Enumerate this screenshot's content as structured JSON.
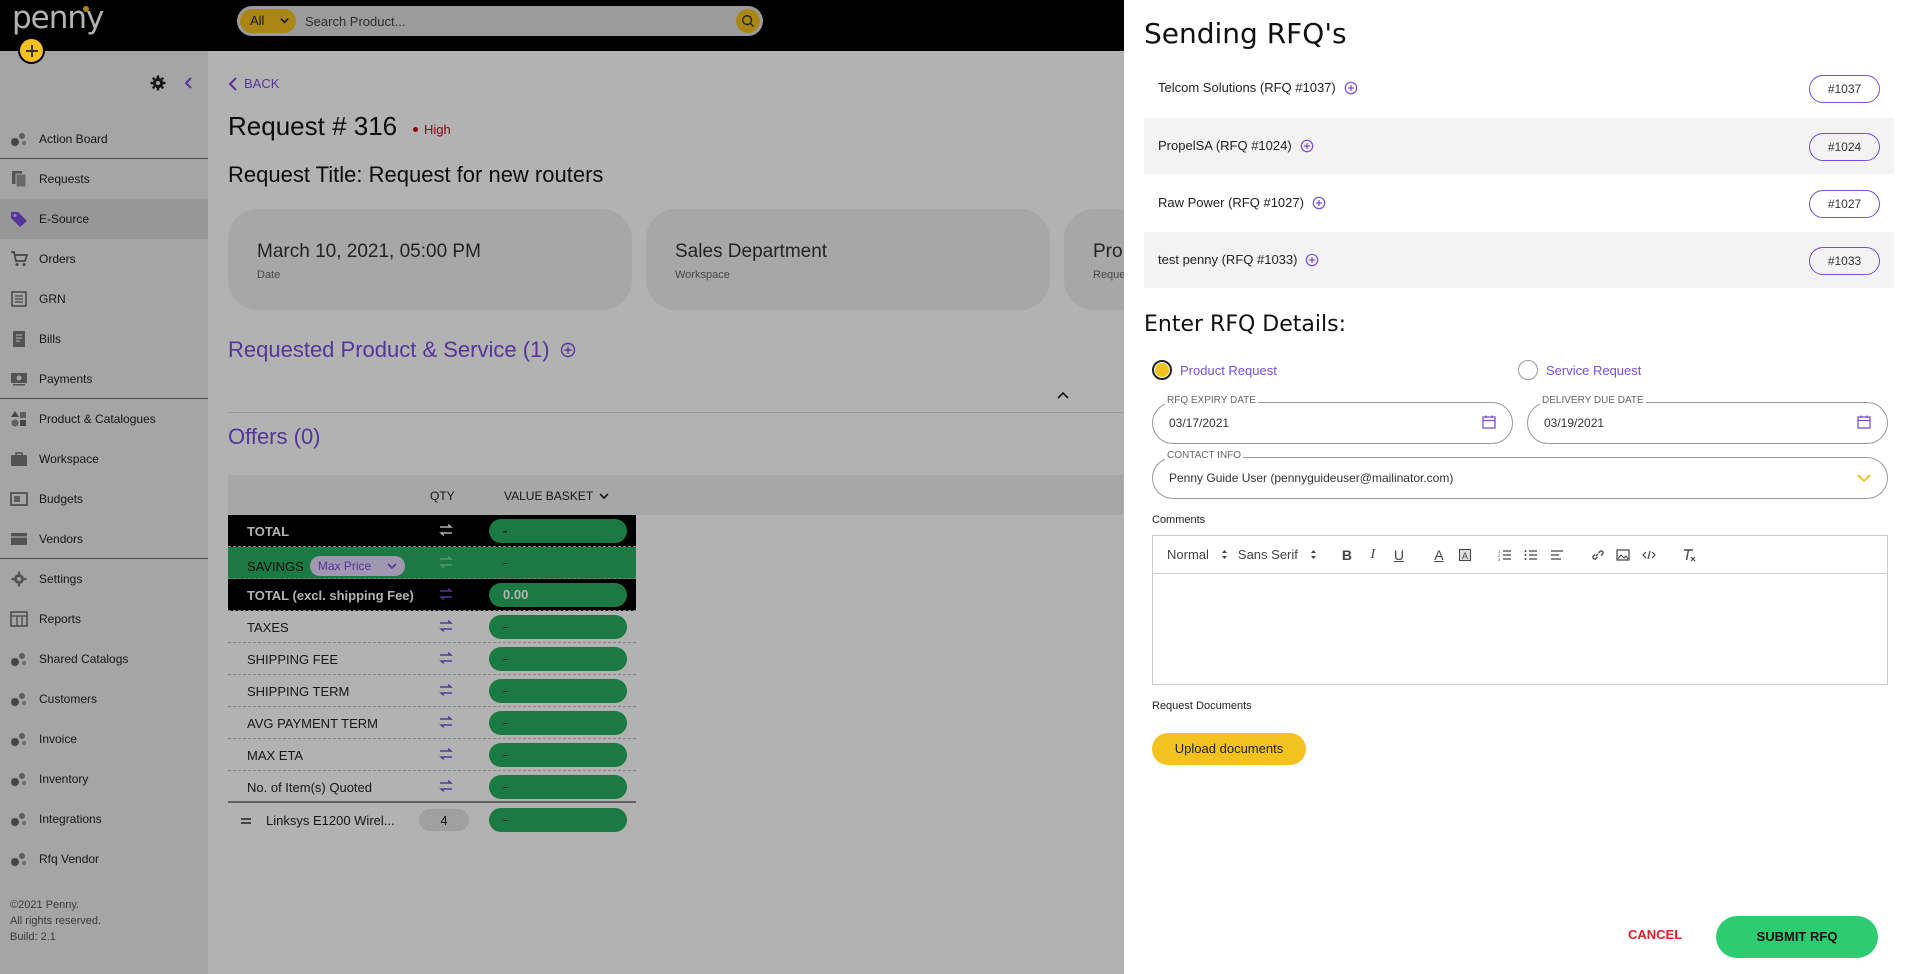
{
  "app": {
    "logo": "penny"
  },
  "search": {
    "scope": "All",
    "placeholder": "Search Product..."
  },
  "sidebar": {
    "items": [
      {
        "label": "Action Board",
        "icon": "dots-icon"
      },
      {
        "label": "Requests",
        "icon": "documents-icon"
      },
      {
        "label": "E-Source",
        "icon": "tag-icon"
      },
      {
        "label": "Orders",
        "icon": "cart-icon"
      },
      {
        "label": "GRN",
        "icon": "list-icon"
      },
      {
        "label": "Bills",
        "icon": "bill-icon"
      },
      {
        "label": "Payments",
        "icon": "payments-icon"
      },
      {
        "label": "Product & Catalogues",
        "icon": "shapes-icon"
      },
      {
        "label": "Workspace",
        "icon": "briefcase-icon"
      },
      {
        "label": "Budgets",
        "icon": "budget-icon"
      },
      {
        "label": "Vendors",
        "icon": "vendors-icon"
      },
      {
        "label": "Settings",
        "icon": "gear-icon"
      },
      {
        "label": "Reports",
        "icon": "table-icon"
      },
      {
        "label": "Shared Catalogs",
        "icon": "dots-icon"
      },
      {
        "label": "Customers",
        "icon": "dots-icon"
      },
      {
        "label": "Invoice",
        "icon": "dots-icon"
      },
      {
        "label": "Inventory",
        "icon": "dots-icon"
      },
      {
        "label": "Integrations",
        "icon": "dots-icon"
      },
      {
        "label": "Rfq Vendor",
        "icon": "dots-icon"
      }
    ],
    "footer": {
      "copyright": "©2021 Penny.",
      "rights": "All rights reserved.",
      "build": "Build: 2.1"
    }
  },
  "main": {
    "back": "BACK",
    "title": "Request # 316",
    "priority": "High",
    "subtitle": "Request Title: Request for new routers",
    "cards": [
      {
        "value": "March 10, 2021, 05:00 PM",
        "label": "Date"
      },
      {
        "value": "Sales Department",
        "label": "Workspace"
      },
      {
        "value": "Pro",
        "label": "Reque"
      }
    ],
    "products_heading": "Requested Product & Service (1)",
    "offers_heading": "Offers (0)",
    "table": {
      "col_qty": "QTY",
      "col_basket": "VALUE BASKET",
      "rows": [
        {
          "label": "TOTAL",
          "value": "-"
        },
        {
          "label": "SAVINGS",
          "badge": "Max Price",
          "value": "-"
        },
        {
          "label": "TOTAL (excl. shipping Fee)",
          "value": "0.00"
        },
        {
          "label": "TAXES",
          "value": "-"
        },
        {
          "label": "SHIPPING FEE",
          "value": "-"
        },
        {
          "label": "SHIPPING TERM",
          "value": "-"
        },
        {
          "label": "AVG PAYMENT TERM",
          "value": "-"
        },
        {
          "label": "MAX ETA",
          "value": "-"
        },
        {
          "label": "No. of Item(s) Quoted",
          "value": "-"
        }
      ],
      "item": {
        "label": "Linksys E1200 Wirel...",
        "qty": "4",
        "value": "-"
      }
    }
  },
  "drawer": {
    "title": "Sending RFQ's",
    "vendors": [
      {
        "name": "Telcom Solutions (RFQ #1037)",
        "tag": "#1037"
      },
      {
        "name": "PropelSA (RFQ #1024)",
        "tag": "#1024"
      },
      {
        "name": "Raw Power (RFQ #1027)",
        "tag": "#1027"
      },
      {
        "name": "test penny (RFQ #1033)",
        "tag": "#1033"
      }
    ],
    "details_heading": "Enter RFQ Details:",
    "radio_product": "Product Request",
    "radio_service": "Service Request",
    "expiry": {
      "label": "RFQ EXPIRY DATE",
      "value": "03/17/2021"
    },
    "due": {
      "label": "DELIVERY DUE DATE",
      "value": "03/19/2021"
    },
    "contact": {
      "label": "CONTACT INFO",
      "value": "Penny Guide User (pennyguideuser@mailinator.com)"
    },
    "comments_label": "Comments",
    "editor": {
      "format": "Normal",
      "font": "Sans Serif"
    },
    "documents_label": "Request Documents",
    "upload": "Upload documents",
    "cancel": "CANCEL",
    "submit": "SUBMIT RFQ"
  },
  "colors": {
    "accent": "#7b4ddb",
    "brand_yellow": "#f4c21f",
    "success": "#2ecc71",
    "danger": "#e0202a"
  }
}
